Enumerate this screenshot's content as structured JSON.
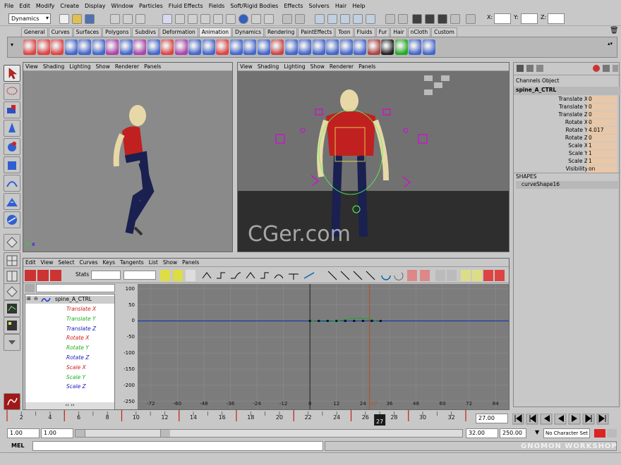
{
  "menu": [
    "File",
    "Edit",
    "Modify",
    "Create",
    "Display",
    "Window",
    "Particles",
    "Fluid Effects",
    "Fields",
    "Soft/Rigid Bodies",
    "Effects",
    "Solvers",
    "Hair",
    "Help"
  ],
  "status": {
    "mode": "Dynamics",
    "xyz": [
      "X:",
      "Y:",
      "Z:"
    ]
  },
  "shelf_tabs": [
    "General",
    "Curves",
    "Surfaces",
    "Polygons",
    "Subdivs",
    "Deformation",
    "Animation",
    "Dynamics",
    "Rendering",
    "PaintEffects",
    "Toon",
    "Fluids",
    "Fur",
    "Hair",
    "nCloth",
    "Custom"
  ],
  "active_shelf_tab": "Animation",
  "viewport_menu": [
    "View",
    "Shading",
    "Lighting",
    "Show",
    "Renderer",
    "Panels"
  ],
  "channel_box": {
    "tabs": [
      "Channels",
      "Object"
    ],
    "object_name": "spine_A_CTRL",
    "channels": [
      {
        "label": "Translate X",
        "value": "0"
      },
      {
        "label": "Translate Y",
        "value": "0"
      },
      {
        "label": "Translate Z",
        "value": "0"
      },
      {
        "label": "Rotate X",
        "value": "0"
      },
      {
        "label": "Rotate Y",
        "value": "4.017"
      },
      {
        "label": "Rotate Z",
        "value": "0"
      },
      {
        "label": "Scale X",
        "value": "1"
      },
      {
        "label": "Scale Y",
        "value": "1"
      },
      {
        "label": "Scale Z",
        "value": "1"
      },
      {
        "label": "Visibility",
        "value": "on"
      }
    ],
    "shapes_header": "SHAPES",
    "shape_name": "curveShape16"
  },
  "graph_editor": {
    "menu": [
      "Edit",
      "View",
      "Select",
      "Curves",
      "Keys",
      "Tangents",
      "List",
      "Show",
      "Panels"
    ],
    "stats_label": "Stats",
    "outliner_root": "spine_A_CTRL",
    "attributes": [
      {
        "label": "Translate X",
        "color": "#d02020"
      },
      {
        "label": "Translate Y",
        "color": "#20b020"
      },
      {
        "label": "Translate Z",
        "color": "#2020c0"
      },
      {
        "label": "Rotate X",
        "color": "#d02020"
      },
      {
        "label": "Rotate Y",
        "color": "#20b020"
      },
      {
        "label": "Rotate Z",
        "color": "#2020c0"
      },
      {
        "label": "Scale X",
        "color": "#d02020"
      },
      {
        "label": "Scale Y",
        "color": "#20b020"
      },
      {
        "label": "Scale Z",
        "color": "#2020c0"
      }
    ],
    "y_ticks": [
      "100",
      "50",
      "0",
      "-50",
      "-100",
      "-150",
      "-200",
      "-250"
    ],
    "x_ticks": [
      "-72",
      "-60",
      "-48",
      "-36",
      "-24",
      "-12",
      "0",
      "12",
      "24",
      "36",
      "48",
      "60",
      "72",
      "84"
    ],
    "current_frame_marker": "27"
  },
  "timeline": {
    "ticks": [
      "2",
      "4",
      "6",
      "8",
      "10",
      "12",
      "14",
      "16",
      "18",
      "20",
      "22",
      "24",
      "26",
      "28",
      "30",
      "32"
    ],
    "current_frame": "27",
    "current_time_field": "27.00"
  },
  "range": {
    "start_time": "1.00",
    "playback_start": "1.00",
    "playback_end": "32.00",
    "end_time": "250.00",
    "character_set": "No Character Set"
  },
  "mel_label": "MEL",
  "watermark": "CGer.com",
  "brand": "GNOMON WORKSHOP"
}
